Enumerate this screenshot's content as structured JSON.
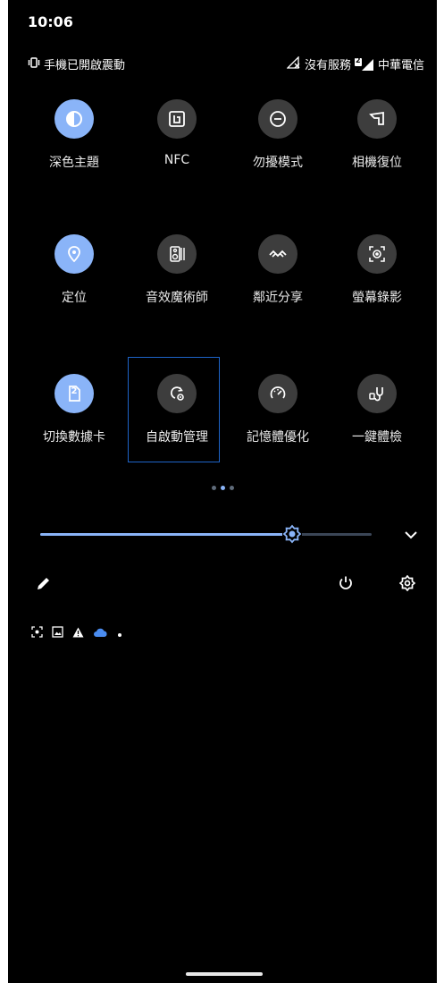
{
  "status_bar": {
    "time": "10:06",
    "left_text": "手機已開啟震動",
    "carrier_status": "沒有服務",
    "sim2_badge": "2",
    "carrier_name": "中華電信"
  },
  "quick_settings": {
    "tiles": [
      {
        "label": "深色主題",
        "icon": "dark-theme-icon",
        "active": true
      },
      {
        "label": "NFC",
        "icon": "nfc-icon",
        "active": false
      },
      {
        "label": "勿擾模式",
        "icon": "do-not-disturb-icon",
        "active": false
      },
      {
        "label": "相機復位",
        "icon": "camera-reset-icon",
        "active": false
      },
      {
        "label": "定位",
        "icon": "location-icon",
        "active": true
      },
      {
        "label": "音效魔術師",
        "icon": "audio-wizard-icon",
        "active": false
      },
      {
        "label": "鄰近分享",
        "icon": "nearby-share-icon",
        "active": false
      },
      {
        "label": "螢幕錄影",
        "icon": "screen-record-icon",
        "active": false
      },
      {
        "label": "切換數據卡",
        "icon": "switch-sim-icon",
        "active": true,
        "badge": "2"
      },
      {
        "label": "自啟動管理",
        "icon": "auto-start-manager-icon",
        "active": false
      },
      {
        "label": "記憶體優化",
        "icon": "memory-optimize-icon",
        "active": false
      },
      {
        "label": "一鍵體檢",
        "icon": "one-click-checkup-icon",
        "active": false
      }
    ],
    "page_indicator": {
      "count": 3,
      "current": 1
    }
  },
  "brightness": {
    "level": 0.76,
    "icon": "brightness-icon"
  },
  "colors": {
    "accent": "#8ab4f8",
    "tile_bg": "#3d3d3d",
    "background": "#000000"
  },
  "notification_icons": [
    "screenshot-icon",
    "image-icon",
    "warning-icon",
    "cloud-icon",
    "dot-icon"
  ]
}
